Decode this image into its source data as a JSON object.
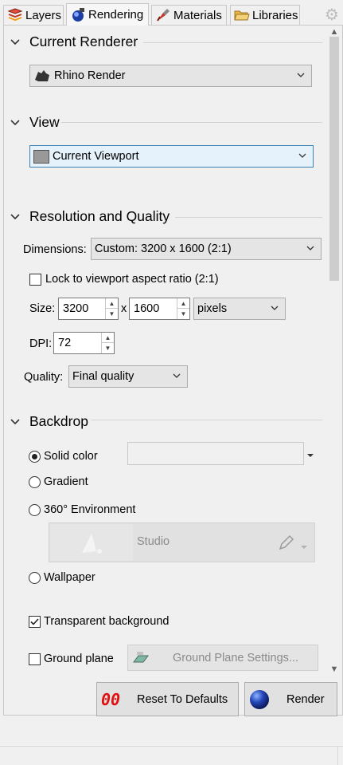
{
  "tabs": [
    {
      "label": "Layers",
      "icon": "layers-icon"
    },
    {
      "label": "Rendering",
      "icon": "rendering-icon"
    },
    {
      "label": "Materials",
      "icon": "materials-icon"
    },
    {
      "label": "Libraries",
      "icon": "folder-icon"
    }
  ],
  "sections": {
    "renderer": {
      "title": "Current Renderer",
      "value": "Rhino Render"
    },
    "view": {
      "title": "View",
      "value": "Current Viewport"
    },
    "resolution": {
      "title": "Resolution and Quality",
      "dimensions_label": "Dimensions:",
      "dimensions_value": "Custom: 3200 x 1600 (2:1)",
      "lock_label": "Lock to viewport aspect ratio (2:1)",
      "lock_checked": false,
      "size_label": "Size:",
      "width": "3200",
      "times": "x",
      "height": "1600",
      "units": "pixels",
      "dpi_label": "DPI:",
      "dpi": "72",
      "quality_label": "Quality:",
      "quality": "Final quality"
    },
    "backdrop": {
      "title": "Backdrop",
      "options": {
        "solid": "Solid color",
        "gradient": "Gradient",
        "env360": "360° Environment",
        "wallpaper": "Wallpaper"
      },
      "selected": "Solid color",
      "environment_name": "Studio",
      "transparent_label": "Transparent background",
      "transparent_checked": true,
      "ground_label": "Ground plane",
      "ground_checked": false,
      "ground_settings": "Ground Plane Settings..."
    }
  },
  "footer": {
    "reset_label": "Reset To Defaults",
    "reset_icon_text": "00",
    "render_label": "Render"
  },
  "colors": {
    "accent_focus": "#3c7fb1",
    "focus_fill": "#e5f1fb",
    "reset_icon_red": "#e01010",
    "render_sphere": "#1a3fa8"
  }
}
